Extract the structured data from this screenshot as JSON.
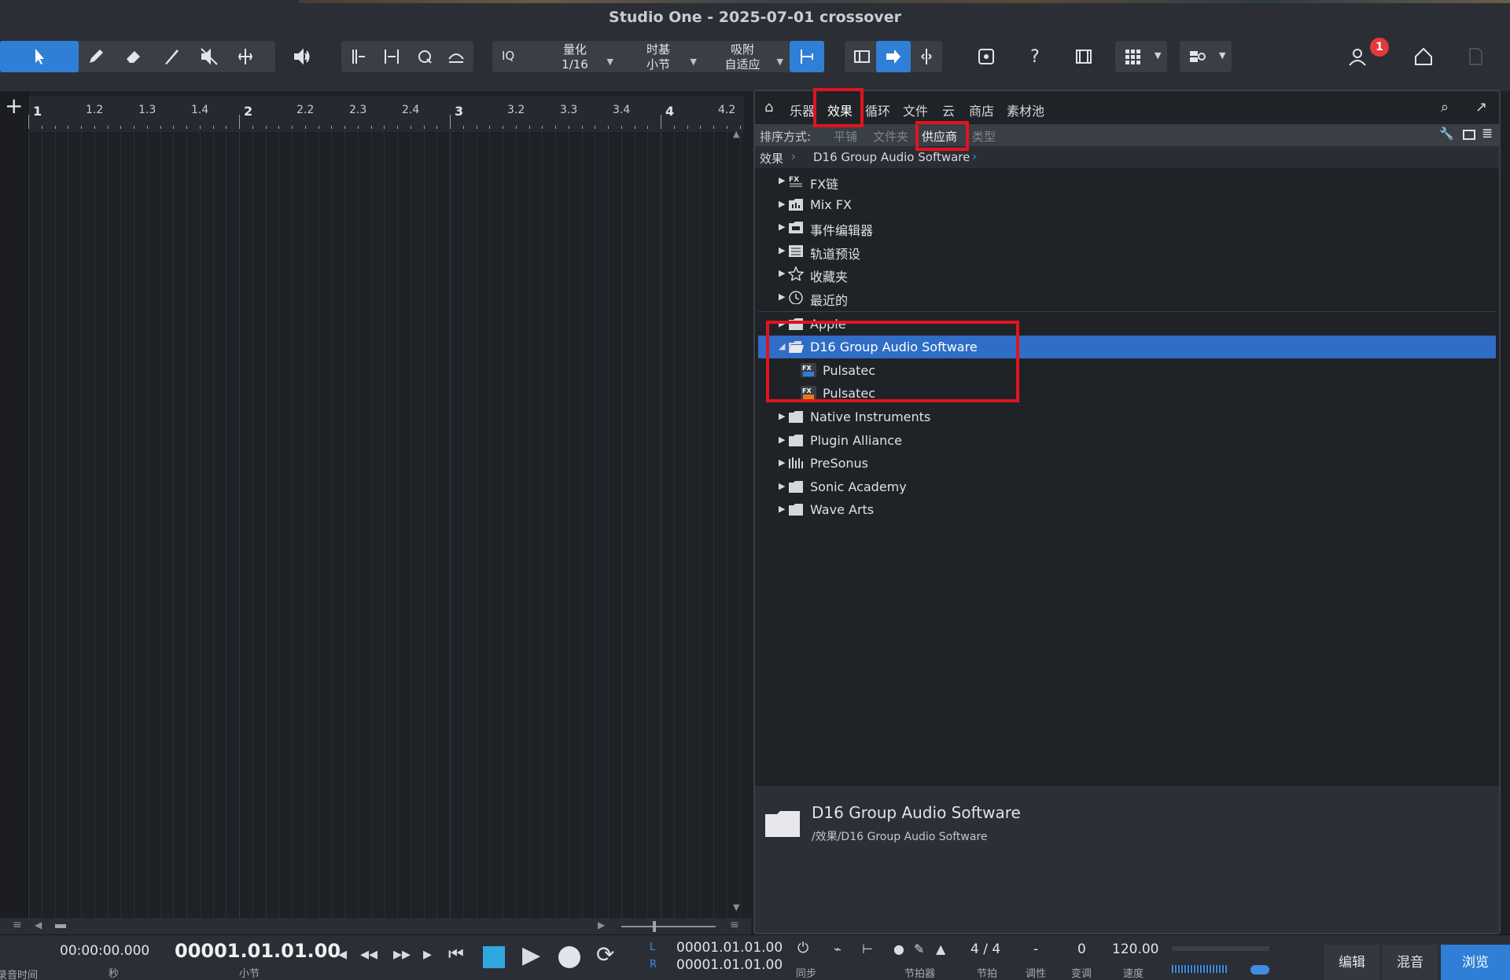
{
  "window": {
    "title": "Studio One - 2025-07-01 crossover"
  },
  "toolbar": {
    "iq_label": "IQ",
    "quantize": {
      "label": "量化",
      "value": "1/16"
    },
    "timebase": {
      "label": "时基",
      "value": "小节"
    },
    "snap": {
      "label": "吸附",
      "value": "自适应"
    },
    "notification_count": "1",
    "help_label": "?"
  },
  "ruler": {
    "ticks": [
      "1",
      "1.2",
      "1.3",
      "1.4",
      "2",
      "2.2",
      "2.3",
      "2.4",
      "3",
      "3.2",
      "3.3",
      "3.4",
      "4",
      "4.2"
    ],
    "major_ticks": [
      "1",
      "2",
      "3",
      "4"
    ]
  },
  "browser": {
    "tabs": [
      "乐器",
      "效果",
      "循环",
      "文件",
      "云",
      "商店",
      "素材池"
    ],
    "active_tab": "效果",
    "sort": {
      "label": "排序方式:",
      "options": [
        "平铺",
        "文件夹",
        "供应商",
        "类型"
      ],
      "active": "供应商"
    },
    "breadcrumb": [
      "效果",
      "D16 Group Audio Software"
    ],
    "items": [
      {
        "label": "FX链",
        "icon": "fx-chain-icon",
        "expanded": false
      },
      {
        "label": "Mix FX",
        "icon": "mix-fx-icon",
        "expanded": false
      },
      {
        "label": "事件编辑器",
        "icon": "event-editor-icon",
        "expanded": false
      },
      {
        "label": "轨道预设",
        "icon": "track-preset-icon",
        "expanded": false
      },
      {
        "label": "收藏夹",
        "icon": "star-icon",
        "expanded": false
      },
      {
        "label": "最近的",
        "icon": "clock-icon",
        "expanded": false
      },
      {
        "label": "Apple",
        "icon": "folder-icon",
        "expanded": false
      },
      {
        "label": "D16 Group Audio Software",
        "icon": "folder-open-icon",
        "expanded": true,
        "selected": true
      },
      {
        "label": "Pulsatec",
        "icon": "fx-vst-icon",
        "child": true,
        "format": "VST3"
      },
      {
        "label": "Pulsatec",
        "icon": "fx-au-icon",
        "child": true,
        "format": "AU"
      },
      {
        "label": "Native Instruments",
        "icon": "folder-icon",
        "expanded": false
      },
      {
        "label": "Plugin Alliance",
        "icon": "folder-icon",
        "expanded": false
      },
      {
        "label": "PreSonus",
        "icon": "presonus-icon",
        "expanded": false
      },
      {
        "label": "Sonic Academy",
        "icon": "folder-icon",
        "expanded": false
      },
      {
        "label": "Wave Arts",
        "icon": "folder-icon",
        "expanded": false
      }
    ],
    "info": {
      "title": "D16 Group Audio Software",
      "path": "/效果/D16 Group Audio Software"
    }
  },
  "transport": {
    "time_label_left": "录音时间",
    "time_seconds": "00:00:00.000",
    "time_seconds_unit": "秒",
    "position": "00001.01.01.00",
    "position_unit": "小节",
    "loop_left": "00001.01.01.00",
    "loop_right": "00001.01.01.00",
    "loop_l": "L",
    "loop_r": "R",
    "sync_label": "同步",
    "metronome_label": "节拍器",
    "signature": "4 / 4",
    "signature_label": "节拍",
    "key": "-",
    "key_label": "调性",
    "transpose": "0",
    "transpose_label": "变调",
    "tempo": "120.00",
    "tempo_label": "速度",
    "modes": [
      "编辑",
      "混音",
      "浏览"
    ],
    "active_mode": "浏览"
  },
  "colors": {
    "accent": "#2f7fd6",
    "selection": "#2f6dc7",
    "highlight": "#e0141e",
    "badge": "#e23a3a"
  }
}
